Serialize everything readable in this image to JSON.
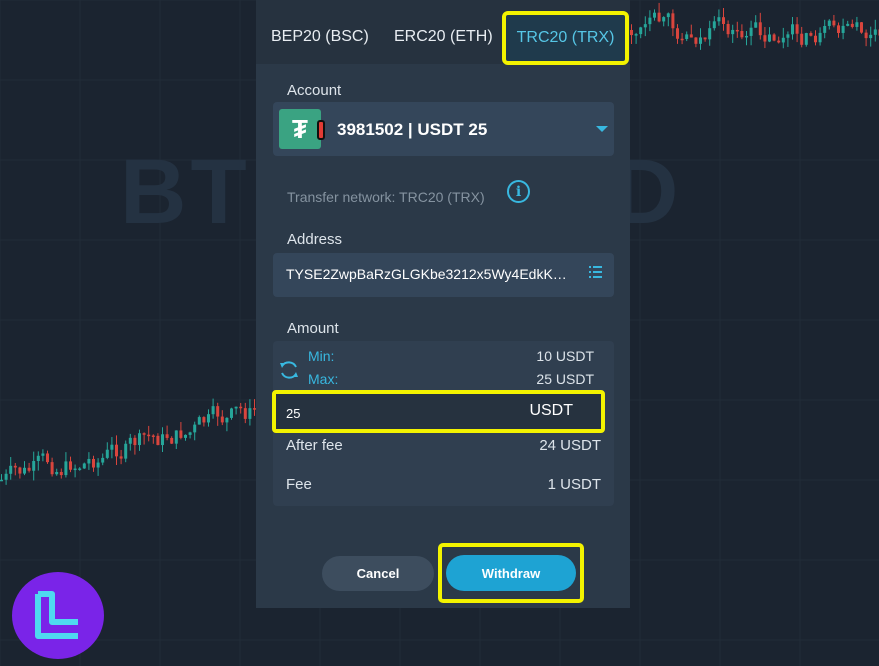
{
  "background": {
    "watermark_left": "BT",
    "watermark_right": "D",
    "chart_colors": {
      "up": "#26a69a",
      "down": "#d9453d"
    }
  },
  "tabs": [
    {
      "label": "BEP20 (BSC)",
      "active": false
    },
    {
      "label": "ERC20 (ETH)",
      "active": false
    },
    {
      "label": "TRC20 (TRX)",
      "active": true
    }
  ],
  "account": {
    "label": "Account",
    "icon": "tether-icon",
    "logo_glyph": "₮",
    "value": "3981502 | USDT 25"
  },
  "network": {
    "text": "Transfer network: TRC20 (TRX)",
    "info_glyph": "i"
  },
  "address": {
    "label": "Address",
    "value": "TYSE2ZwpBaRzGLGKbe3212x5Wy4EdkK…"
  },
  "amount": {
    "label": "Amount",
    "min_label": "Min:",
    "min_value": "10 USDT",
    "max_label": "Max:",
    "max_value": "25 USDT",
    "input_value": "25",
    "currency": "USDT",
    "after_fee_label": "After fee",
    "after_fee_value": "24 USDT",
    "fee_label": "Fee",
    "fee_value": "1 USDT"
  },
  "buttons": {
    "cancel": "Cancel",
    "withdraw": "Withdraw"
  },
  "colors": {
    "accent": "#1ea3d3",
    "highlight": "#f3f300",
    "brand_logo": "#7a24e8"
  }
}
